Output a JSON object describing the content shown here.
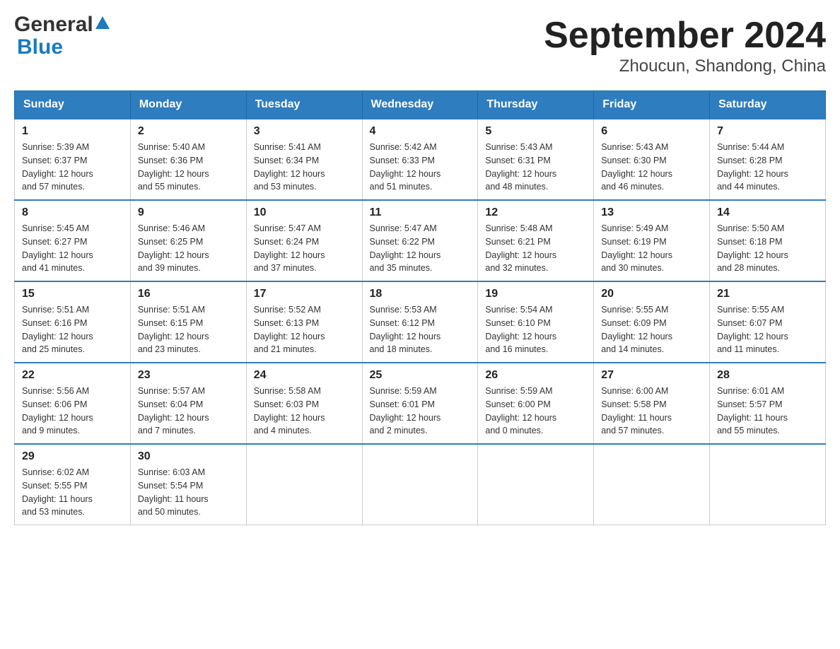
{
  "header": {
    "title": "September 2024",
    "subtitle": "Zhoucun, Shandong, China",
    "logo": {
      "general": "General",
      "blue": "Blue"
    }
  },
  "weekdays": [
    "Sunday",
    "Monday",
    "Tuesday",
    "Wednesday",
    "Thursday",
    "Friday",
    "Saturday"
  ],
  "weeks": [
    [
      {
        "day": "1",
        "sunrise": "5:39 AM",
        "sunset": "6:37 PM",
        "daylight": "12 hours and 57 minutes."
      },
      {
        "day": "2",
        "sunrise": "5:40 AM",
        "sunset": "6:36 PM",
        "daylight": "12 hours and 55 minutes."
      },
      {
        "day": "3",
        "sunrise": "5:41 AM",
        "sunset": "6:34 PM",
        "daylight": "12 hours and 53 minutes."
      },
      {
        "day": "4",
        "sunrise": "5:42 AM",
        "sunset": "6:33 PM",
        "daylight": "12 hours and 51 minutes."
      },
      {
        "day": "5",
        "sunrise": "5:43 AM",
        "sunset": "6:31 PM",
        "daylight": "12 hours and 48 minutes."
      },
      {
        "day": "6",
        "sunrise": "5:43 AM",
        "sunset": "6:30 PM",
        "daylight": "12 hours and 46 minutes."
      },
      {
        "day": "7",
        "sunrise": "5:44 AM",
        "sunset": "6:28 PM",
        "daylight": "12 hours and 44 minutes."
      }
    ],
    [
      {
        "day": "8",
        "sunrise": "5:45 AM",
        "sunset": "6:27 PM",
        "daylight": "12 hours and 41 minutes."
      },
      {
        "day": "9",
        "sunrise": "5:46 AM",
        "sunset": "6:25 PM",
        "daylight": "12 hours and 39 minutes."
      },
      {
        "day": "10",
        "sunrise": "5:47 AM",
        "sunset": "6:24 PM",
        "daylight": "12 hours and 37 minutes."
      },
      {
        "day": "11",
        "sunrise": "5:47 AM",
        "sunset": "6:22 PM",
        "daylight": "12 hours and 35 minutes."
      },
      {
        "day": "12",
        "sunrise": "5:48 AM",
        "sunset": "6:21 PM",
        "daylight": "12 hours and 32 minutes."
      },
      {
        "day": "13",
        "sunrise": "5:49 AM",
        "sunset": "6:19 PM",
        "daylight": "12 hours and 30 minutes."
      },
      {
        "day": "14",
        "sunrise": "5:50 AM",
        "sunset": "6:18 PM",
        "daylight": "12 hours and 28 minutes."
      }
    ],
    [
      {
        "day": "15",
        "sunrise": "5:51 AM",
        "sunset": "6:16 PM",
        "daylight": "12 hours and 25 minutes."
      },
      {
        "day": "16",
        "sunrise": "5:51 AM",
        "sunset": "6:15 PM",
        "daylight": "12 hours and 23 minutes."
      },
      {
        "day": "17",
        "sunrise": "5:52 AM",
        "sunset": "6:13 PM",
        "daylight": "12 hours and 21 minutes."
      },
      {
        "day": "18",
        "sunrise": "5:53 AM",
        "sunset": "6:12 PM",
        "daylight": "12 hours and 18 minutes."
      },
      {
        "day": "19",
        "sunrise": "5:54 AM",
        "sunset": "6:10 PM",
        "daylight": "12 hours and 16 minutes."
      },
      {
        "day": "20",
        "sunrise": "5:55 AM",
        "sunset": "6:09 PM",
        "daylight": "12 hours and 14 minutes."
      },
      {
        "day": "21",
        "sunrise": "5:55 AM",
        "sunset": "6:07 PM",
        "daylight": "12 hours and 11 minutes."
      }
    ],
    [
      {
        "day": "22",
        "sunrise": "5:56 AM",
        "sunset": "6:06 PM",
        "daylight": "12 hours and 9 minutes."
      },
      {
        "day": "23",
        "sunrise": "5:57 AM",
        "sunset": "6:04 PM",
        "daylight": "12 hours and 7 minutes."
      },
      {
        "day": "24",
        "sunrise": "5:58 AM",
        "sunset": "6:03 PM",
        "daylight": "12 hours and 4 minutes."
      },
      {
        "day": "25",
        "sunrise": "5:59 AM",
        "sunset": "6:01 PM",
        "daylight": "12 hours and 2 minutes."
      },
      {
        "day": "26",
        "sunrise": "5:59 AM",
        "sunset": "6:00 PM",
        "daylight": "12 hours and 0 minutes."
      },
      {
        "day": "27",
        "sunrise": "6:00 AM",
        "sunset": "5:58 PM",
        "daylight": "11 hours and 57 minutes."
      },
      {
        "day": "28",
        "sunrise": "6:01 AM",
        "sunset": "5:57 PM",
        "daylight": "11 hours and 55 minutes."
      }
    ],
    [
      {
        "day": "29",
        "sunrise": "6:02 AM",
        "sunset": "5:55 PM",
        "daylight": "11 hours and 53 minutes."
      },
      {
        "day": "30",
        "sunrise": "6:03 AM",
        "sunset": "5:54 PM",
        "daylight": "11 hours and 50 minutes."
      },
      null,
      null,
      null,
      null,
      null
    ]
  ]
}
